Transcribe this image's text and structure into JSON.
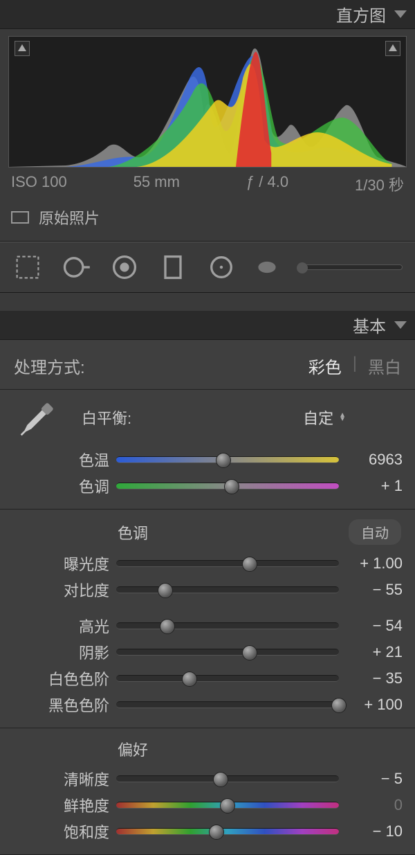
{
  "header_histogram": "直方图",
  "header_basic": "基本",
  "exif": {
    "iso": "ISO 100",
    "focal": "55 mm",
    "aperture": "ƒ / 4.0",
    "shutter": "1/30 秒"
  },
  "original_label": "原始照片",
  "treatment": {
    "label": "处理方式:",
    "color": "彩色",
    "bw": "黑白",
    "sep": "|"
  },
  "wb": {
    "label": "白平衡:",
    "preset": "自定"
  },
  "sliders": {
    "temp": {
      "label": "色温",
      "value": "6963",
      "pos": 48
    },
    "tint": {
      "label": "色调",
      "value": "+ 1",
      "pos": 52
    },
    "exposure": {
      "label": "曝光度",
      "value": "+ 1.00",
      "pos": 60
    },
    "contrast": {
      "label": "对比度",
      "value": "− 55",
      "pos": 22
    },
    "highlights": {
      "label": "高光",
      "value": "− 54",
      "pos": 23
    },
    "shadows": {
      "label": "阴影",
      "value": "+ 21",
      "pos": 60
    },
    "whites": {
      "label": "白色色阶",
      "value": "− 35",
      "pos": 33
    },
    "blacks": {
      "label": "黑色色阶",
      "value": "+ 100",
      "pos": 100
    },
    "clarity": {
      "label": "清晰度",
      "value": "− 5",
      "pos": 47
    },
    "vibrance": {
      "label": "鲜艳度",
      "value": "0",
      "pos": 50
    },
    "saturation": {
      "label": "饱和度",
      "value": "− 10",
      "pos": 45
    }
  },
  "tone_header": "色调",
  "auto_label": "自动",
  "presence_header": "偏好"
}
